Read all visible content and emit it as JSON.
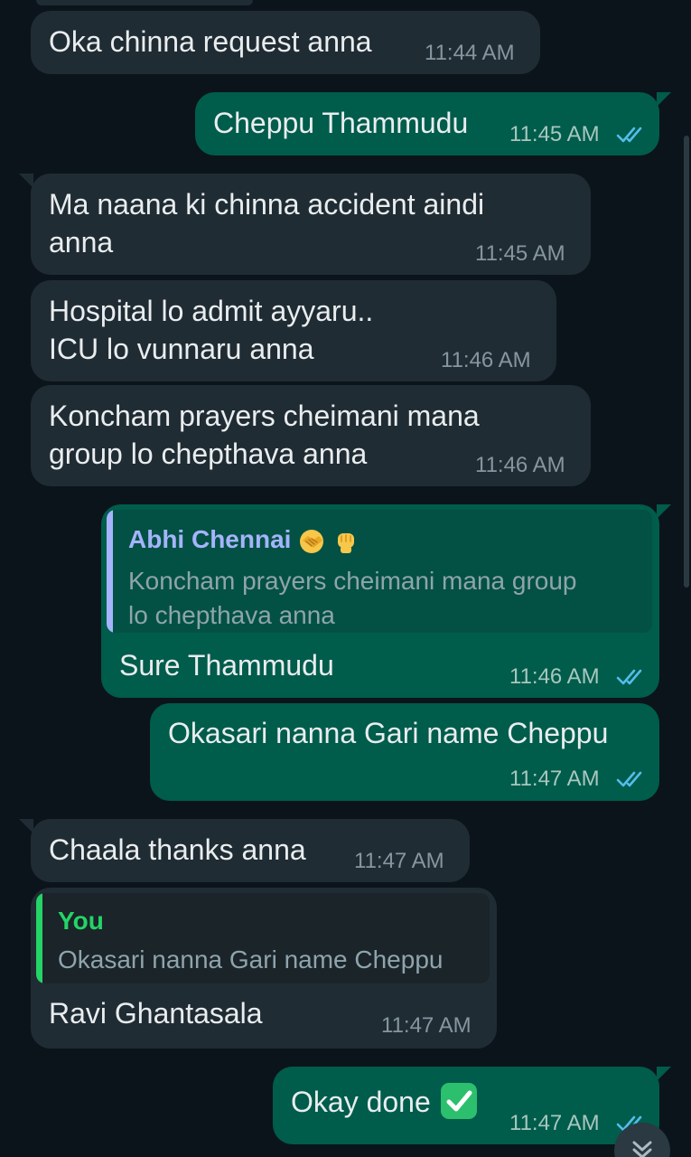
{
  "colors": {
    "background": "#0b141a",
    "incoming_bubble": "#202c33",
    "outgoing_bubble": "#005c4b",
    "read_ticks": "#53bdeb",
    "reply_author_abhi": "#a5b4fc",
    "reply_author_you": "#25d366"
  },
  "messages": [
    {
      "text": "Oka chinna request anna",
      "time": "11:44 AM"
    },
    {
      "text": "Cheppu Thammudu",
      "time": "11:45 AM",
      "status": "read"
    },
    {
      "line1": "Ma naana ki chinna accident aindi",
      "line2": "anna",
      "time": "11:45 AM"
    },
    {
      "line1": "Hospital lo admit ayyaru..",
      "line2": "ICU lo vunnaru anna",
      "time": "11:46 AM"
    },
    {
      "line1": "Koncham prayers cheimani mana",
      "line2": "group lo chepthava anna",
      "time": "11:46 AM"
    },
    {
      "reply_author": "Abhi Chennai",
      "reply_author_emojis": [
        "handshake-emoji",
        "raised-fist-emoji"
      ],
      "reply_line1": "Koncham prayers cheimani mana group",
      "reply_line2": "lo chepthava anna",
      "text": "Sure Thammudu",
      "time": "11:46 AM",
      "status": "read"
    },
    {
      "text": "Okasari nanna Gari name Cheppu",
      "time": "11:47 AM",
      "status": "read"
    },
    {
      "text": "Chaala thanks anna",
      "time": "11:47 AM"
    },
    {
      "reply_author": "You",
      "reply_line1": "Okasari nanna Gari name Cheppu",
      "text": "Ravi Ghantasala",
      "time": "11:47 AM"
    },
    {
      "text": "Okay done",
      "emoji": "check-mark-button-emoji",
      "time": "11:47 AM",
      "status": "read"
    }
  ],
  "scroll_button": {
    "icon": "chevron-down-icon"
  }
}
